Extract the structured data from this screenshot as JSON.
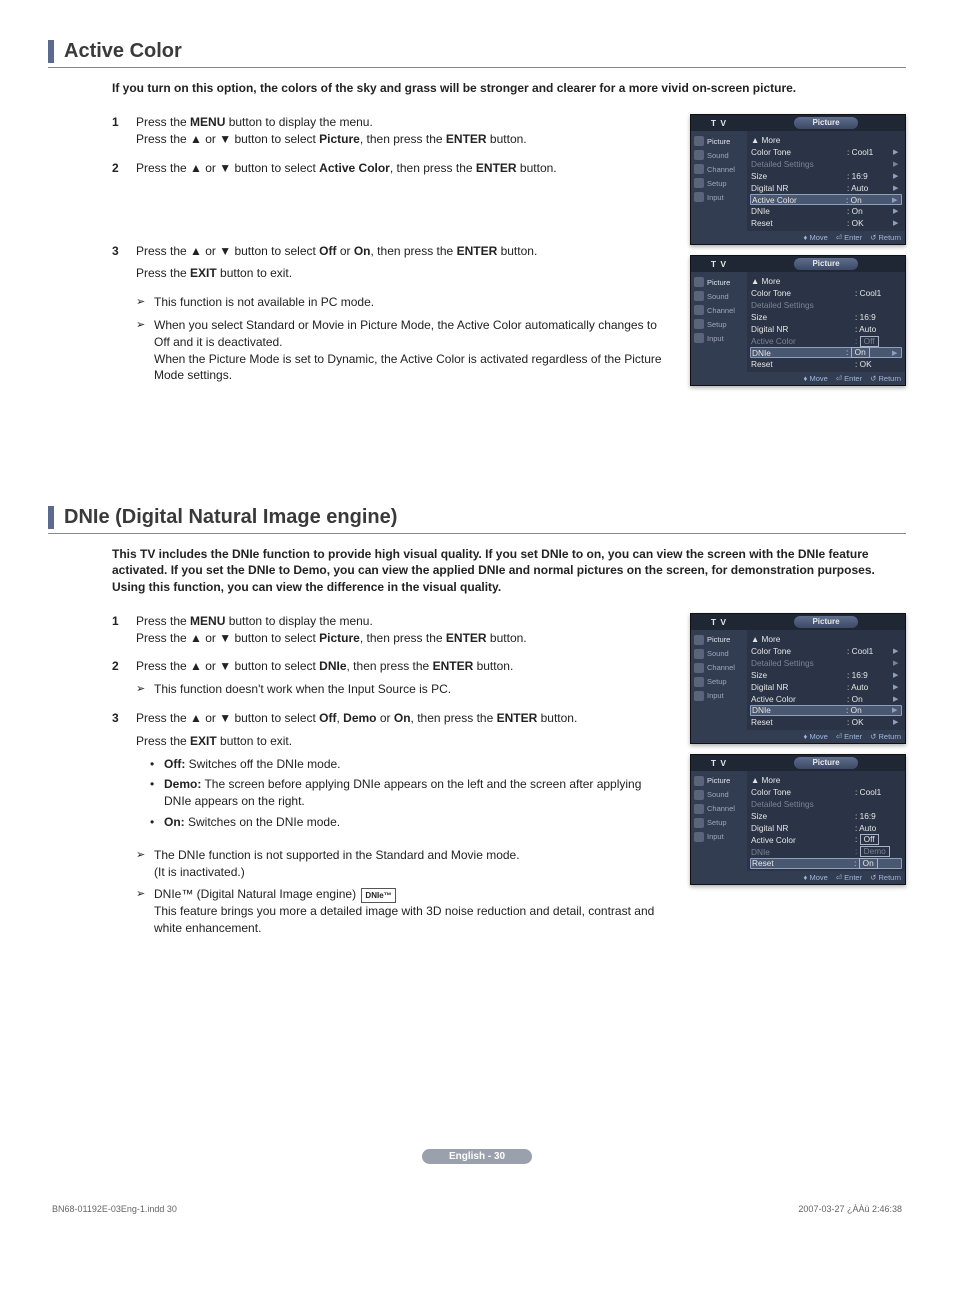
{
  "section1": {
    "heading": "Active Color",
    "intro": "If you turn on this option, the colors of the sky and grass will be stronger and clearer for a more vivid on-screen picture.",
    "step1a": "Press the ",
    "step1b": " button to display the menu.",
    "step1c": "Press the ▲ or ▼ button to select ",
    "step1d": ", then press the ",
    "step1e": " button.",
    "menu": "MENU",
    "picture": "Picture",
    "enter": "ENTER",
    "active_color": "Active Color",
    "step2a": "Press the ▲ or ▼ button to select ",
    "step2b": ", then press the ",
    "step2c": " button.",
    "step3a": "Press the ▲ or ▼ button to select ",
    "off": "Off",
    "or": " or ",
    "on": "On",
    "step3b": ", then press the ",
    "step3c": " button.",
    "exit_a": "Press the ",
    "exit_b": " button to exit.",
    "exit": "EXIT",
    "note1": "This function is not available in PC mode.",
    "note2_l1": "When you select Standard or Movie in Picture Mode, the Active Color automatically changes to Off and it is deactivated.",
    "note2_l2": "When the Picture Mode is set to Dynamic, the Active Color is activated regardless of the Picture Mode settings."
  },
  "section2": {
    "heading": "DNIe (Digital Natural Image engine)",
    "intro": "This TV includes the DNIe function to provide high visual quality. If you set DNIe to on, you can view the screen with the DNIe feature activated. If you set the DNIe to Demo, you can view the applied DNIe and normal pictures on the screen, for demonstration purposes. Using this function, you can view the difference in the visual quality.",
    "step1a": "Press the ",
    "step1b": " button to display the menu.",
    "step1c": "Press the ▲ or ▼ button to select ",
    "step1d": ", then press the ",
    "step1e": " button.",
    "menu": "MENU",
    "picture": "Picture",
    "enter": "ENTER",
    "dnie": "DNIe",
    "step2a": "Press the ▲ or ▼ button to select ",
    "step2b": ", then press the ",
    "step2c": " button.",
    "step2_note": "This function doesn't work when the Input Source is PC.",
    "step3a": "Press the ▲ or ▼ button to select ",
    "off": "Off",
    "demo": "Demo",
    "on": "On",
    "comma": ", ",
    "or": " or ",
    "step3b": ", then press the ",
    "step3c": " button.",
    "exit_a": "Press the ",
    "exit_b": " button to exit.",
    "exit": "EXIT",
    "off_label": "Off:",
    "off_desc": " Switches off the DNIe mode.",
    "demo_label": "Demo:",
    "demo_desc": " The screen before applying DNIe appears on the left and the screen after applying DNIe appears on the right.",
    "on_label": "On:",
    "on_desc": " Switches on the DNIe mode.",
    "note1_l1": "The DNIe function is not supported in the Standard and Movie mode.",
    "note1_l2": "(It is inactivated.)",
    "note2_l1a": "DNIe™ (Digital Natural Image engine) ",
    "note2_logo": "DNIe™",
    "note2_l2": "This feature brings you more a detailed image with 3D noise reduction and detail, contrast and white enhancement."
  },
  "osd": {
    "tv": "T  V",
    "title": "Picture",
    "side": [
      "Picture",
      "Sound",
      "Channel",
      "Setup",
      "Input"
    ],
    "more": "▲ More",
    "color_tone": "Color Tone",
    "detailed": "Detailed Settings",
    "size": "Size",
    "digital_nr": "Digital NR",
    "active_color": "Active Color",
    "dnie": "DNIe",
    "reset": "Reset",
    "cool1": ": Cool1",
    "v169": ": 16:9",
    "auto": ": Auto",
    "on": ": On",
    "off": "Off",
    "on_plain": "On",
    "demo": "Demo",
    "ok": ": OK",
    "colon": ": ",
    "footer_move": "Move",
    "footer_enter": "Enter",
    "footer_return": "Return"
  },
  "page_pill": "English - 30",
  "print_left": "BN68-01192E-03Eng-1.indd   30",
  "print_right": "2007-03-27   ¿ÀÀü 2:46:38"
}
